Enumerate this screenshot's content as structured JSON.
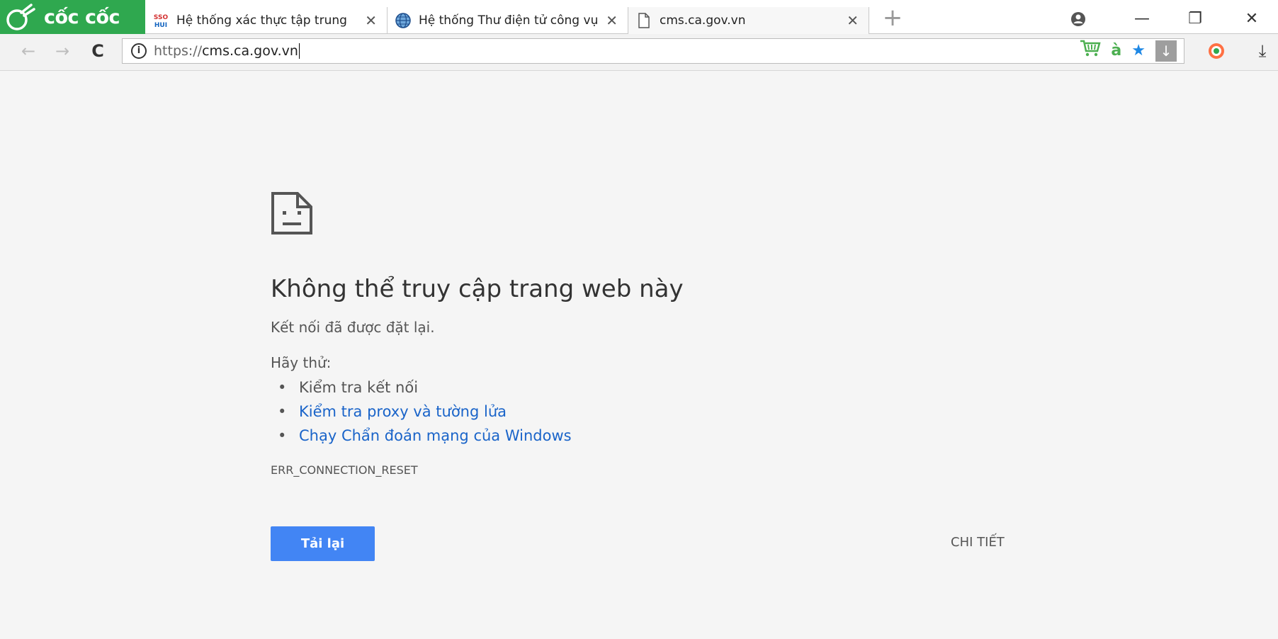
{
  "browser": {
    "brand_name": "cốc cốc",
    "brand_color": "#2fa84f",
    "tabs": [
      {
        "title": "Hệ thống xác thực tập trung",
        "icon": "ssohui-icon",
        "active": false
      },
      {
        "title": "Hệ thống Thư điện tử công vụ",
        "icon": "globe-icon",
        "active": false
      },
      {
        "title": "cms.ca.gov.vn",
        "icon": "page-icon",
        "active": true
      }
    ],
    "close_glyph": "✕",
    "new_tab_glyph": "+",
    "window_controls": {
      "profile": "profile-icon",
      "minimize": "—",
      "restore": "❐",
      "close": "✕"
    }
  },
  "toolbar": {
    "back_glyph": "←",
    "forward_glyph": "→",
    "reload_glyph": "C",
    "url_scheme": "https://",
    "url_host": "cms.ca.gov.vn",
    "extensions": [
      "cart-icon",
      "a-grave-icon",
      "star-icon",
      "download-icon"
    ],
    "ext_a_glyph": "à",
    "ext_star_glyph": "★",
    "ext_download_glyph": "↓",
    "downloads_glyph": "⤓"
  },
  "error_page": {
    "title": "Không thể truy cập trang web này",
    "description": "Kết nối đã được đặt lại.",
    "try_label": "Hãy thử:",
    "suggestions": [
      {
        "text": "Kiểm tra kết nối",
        "link": false
      },
      {
        "text": "Kiểm tra proxy và tường lửa",
        "link": true
      },
      {
        "text": "Chạy Chẩn đoán mạng của Windows",
        "link": true
      }
    ],
    "error_code": "ERR_CONNECTION_RESET",
    "reload_button": "Tải lại",
    "details_button": "CHI TIẾT",
    "accent_color": "#4285f4",
    "link_color": "#1a64c9"
  }
}
